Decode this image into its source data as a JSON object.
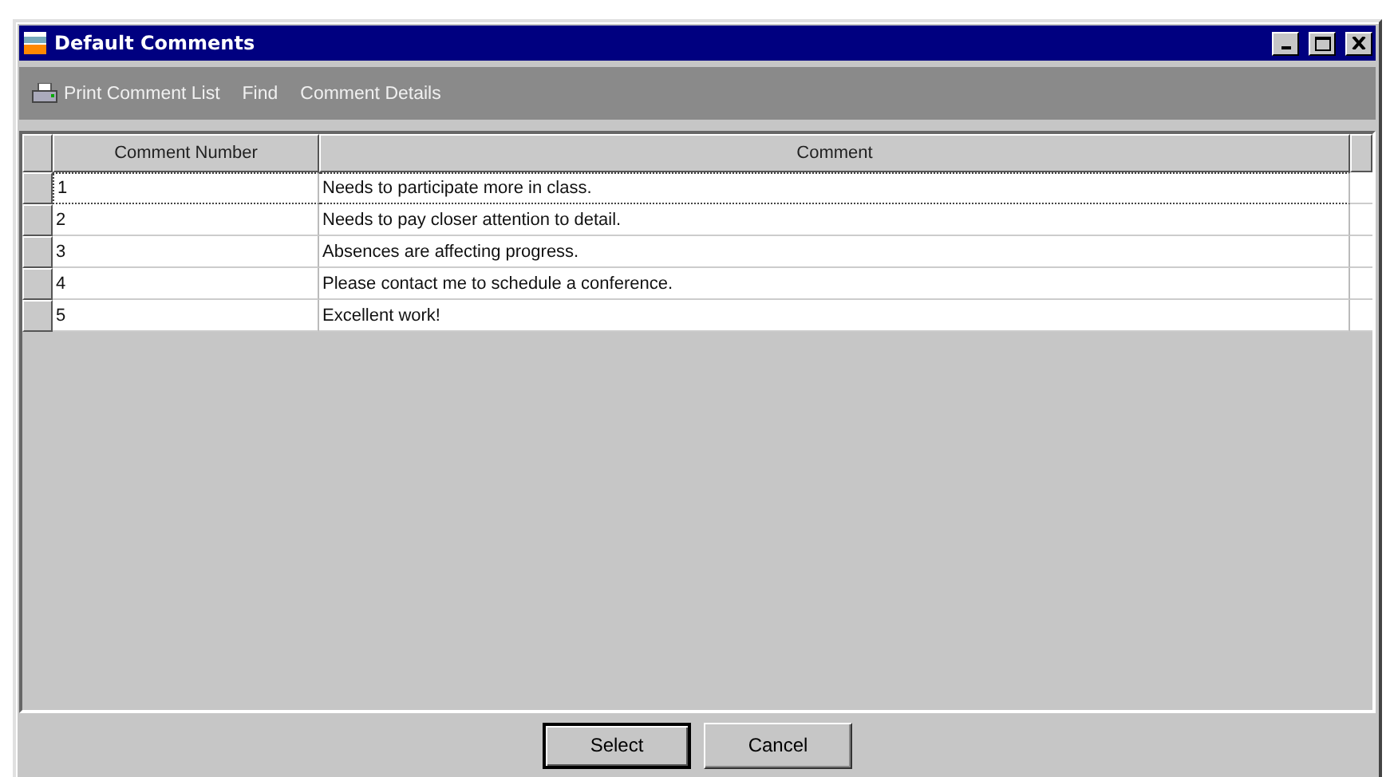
{
  "window": {
    "title": "Default Comments"
  },
  "toolbar": {
    "items": [
      {
        "label": "Print Comment List",
        "kind": "print"
      },
      {
        "label": "Find",
        "kind": "plain"
      },
      {
        "label": "Comment Details",
        "kind": "plain"
      }
    ]
  },
  "table": {
    "columns": [
      "Comment Number",
      "Comment"
    ],
    "rows": [
      {
        "number": "1",
        "comment": "Needs to participate more in class.",
        "selected": true
      },
      {
        "number": "2",
        "comment": "Needs to pay closer attention to detail.",
        "selected": false
      },
      {
        "number": "3",
        "comment": "Absences are affecting progress.",
        "selected": false
      },
      {
        "number": "4",
        "comment": "Please contact me to schedule a conference.",
        "selected": false
      },
      {
        "number": "5",
        "comment": "Excellent work!",
        "selected": false
      }
    ]
  },
  "buttons": [
    {
      "label": "Select",
      "default": true
    },
    {
      "label": "Cancel",
      "default": false
    }
  ]
}
